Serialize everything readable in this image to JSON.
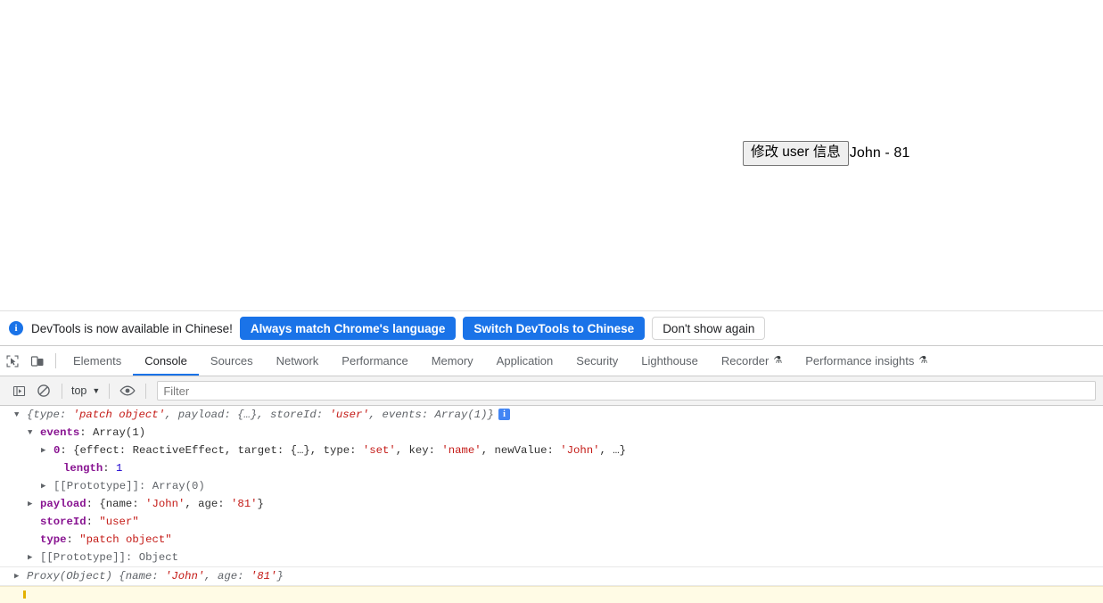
{
  "page": {
    "button_label": "修改 user 信息",
    "user_display": "John - 81"
  },
  "notification": {
    "icon": "info-icon",
    "icon_glyph": "i",
    "message": "DevTools is now available in Chinese!",
    "primary_button": "Always match Chrome's language",
    "secondary_button": "Switch DevTools to Chinese",
    "dismiss_button": "Don't show again",
    "accent_color": "#1a73e8"
  },
  "devtools": {
    "inspect_icon": "inspect-element-icon",
    "device_icon": "device-toolbar-icon",
    "tabs": [
      {
        "label": "Elements",
        "active": false,
        "beaker": false
      },
      {
        "label": "Console",
        "active": true,
        "beaker": false
      },
      {
        "label": "Sources",
        "active": false,
        "beaker": false
      },
      {
        "label": "Network",
        "active": false,
        "beaker": false
      },
      {
        "label": "Performance",
        "active": false,
        "beaker": false
      },
      {
        "label": "Memory",
        "active": false,
        "beaker": false
      },
      {
        "label": "Application",
        "active": false,
        "beaker": false
      },
      {
        "label": "Security",
        "active": false,
        "beaker": false
      },
      {
        "label": "Lighthouse",
        "active": false,
        "beaker": false
      },
      {
        "label": "Recorder",
        "active": false,
        "beaker": true
      },
      {
        "label": "Performance insights",
        "active": false,
        "beaker": true
      }
    ],
    "active_tab_color": "#1a73e8"
  },
  "console_toolbar": {
    "sidebar_icon": "console-sidebar-icon",
    "clear_icon": "clear-console-icon",
    "context": "top",
    "context_caret": "▼",
    "eye_icon": "live-expression-eye-icon",
    "filter_placeholder": "Filter",
    "filter_value": ""
  },
  "console": {
    "entries": [
      {
        "id": "object-log",
        "lines": [
          {
            "indent": 0,
            "arrow": "open",
            "segments": [
              {
                "t": "{type: ",
                "c": "tok-italic"
              },
              {
                "t": "'patch object'",
                "c": "tok-string-i"
              },
              {
                "t": ", payload: {…}, storeId: ",
                "c": "tok-italic"
              },
              {
                "t": "'user'",
                "c": "tok-string-i"
              },
              {
                "t": ", events: Array(1)}",
                "c": "tok-italic"
              }
            ],
            "badge": "i"
          },
          {
            "indent": 1,
            "arrow": "open",
            "segments": [
              {
                "t": "events",
                "c": "tok-prop"
              },
              {
                "t": ": Array(1)",
                "c": "tok-plain"
              }
            ]
          },
          {
            "indent": 2,
            "arrow": "closed",
            "segments": [
              {
                "t": "0",
                "c": "tok-prop"
              },
              {
                "t": ": {effect: ReactiveEffect, target: {…}, type: ",
                "c": "tok-plain"
              },
              {
                "t": "'set'",
                "c": "tok-string"
              },
              {
                "t": ", key: ",
                "c": "tok-plain"
              },
              {
                "t": "'name'",
                "c": "tok-string"
              },
              {
                "t": ", newValue: ",
                "c": "tok-plain"
              },
              {
                "t": "'John'",
                "c": "tok-string"
              },
              {
                "t": ", …}",
                "c": "tok-plain"
              }
            ]
          },
          {
            "indent": 3,
            "arrow": "none",
            "segments": [
              {
                "t": "length",
                "c": "tok-prop"
              },
              {
                "t": ": ",
                "c": "tok-plain"
              },
              {
                "t": "1",
                "c": "tok-num"
              }
            ]
          },
          {
            "indent": 2,
            "arrow": "closed",
            "segments": [
              {
                "t": "[[Prototype]]: Array(0)",
                "c": "tok-proto"
              }
            ]
          },
          {
            "indent": 1,
            "arrow": "closed",
            "segments": [
              {
                "t": "payload",
                "c": "tok-prop"
              },
              {
                "t": ": {name: ",
                "c": "tok-plain"
              },
              {
                "t": "'John'",
                "c": "tok-string"
              },
              {
                "t": ", age: ",
                "c": "tok-plain"
              },
              {
                "t": "'81'",
                "c": "tok-string"
              },
              {
                "t": "}",
                "c": "tok-plain"
              }
            ]
          },
          {
            "indent": 1,
            "arrow": "none",
            "segments": [
              {
                "t": "storeId",
                "c": "tok-prop"
              },
              {
                "t": ": ",
                "c": "tok-plain"
              },
              {
                "t": "\"user\"",
                "c": "tok-dq"
              }
            ]
          },
          {
            "indent": 1,
            "arrow": "none",
            "segments": [
              {
                "t": "type",
                "c": "tok-prop"
              },
              {
                "t": ": ",
                "c": "tok-plain"
              },
              {
                "t": "\"patch object\"",
                "c": "tok-dq"
              }
            ]
          },
          {
            "indent": 1,
            "arrow": "closed",
            "segments": [
              {
                "t": "[[Prototype]]: Object",
                "c": "tok-proto"
              }
            ]
          }
        ]
      },
      {
        "id": "proxy-log",
        "lines": [
          {
            "indent": 0,
            "arrow": "closed",
            "segments": [
              {
                "t": "Proxy(Object) {name: ",
                "c": "tok-italic"
              },
              {
                "t": "'John'",
                "c": "tok-string-i"
              },
              {
                "t": ", age: ",
                "c": "tok-italic"
              },
              {
                "t": "'81'",
                "c": "tok-string-i"
              },
              {
                "t": "}",
                "c": "tok-italic"
              }
            ]
          }
        ]
      }
    ],
    "warning_row_color": "#fffbe5"
  }
}
